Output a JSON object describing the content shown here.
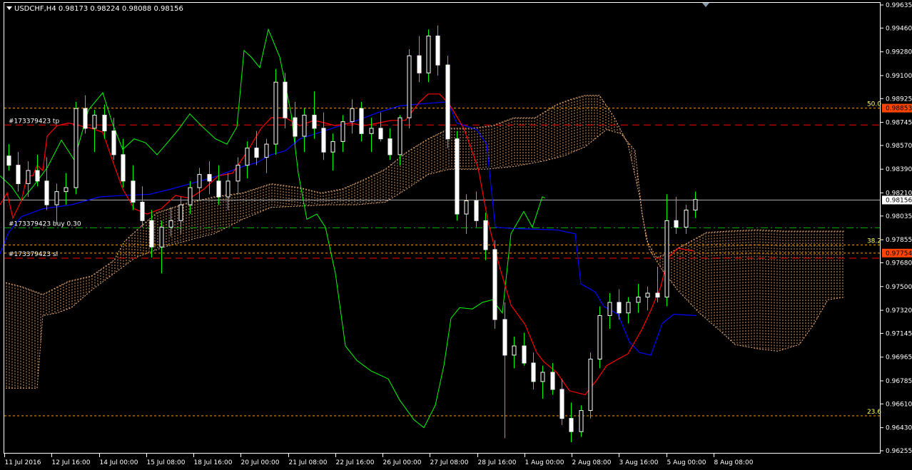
{
  "header": {
    "symbol_line": "USDCHF,H4  0.98173 0.98224 0.98088 0.98156",
    "menu_icon": "triangle-down-icon",
    "scroll_marker_icon": "triangle-down-icon"
  },
  "colors": {
    "background": "#000000",
    "frame": "#ffffff",
    "candle": "#ffffff",
    "wick": "#00ff00",
    "tenkan": "#ff0000",
    "kijun": "#0000ff",
    "chikou": "#00ff00",
    "cloud": "#f0b078",
    "order_line": "#ff0000",
    "buy_line": "#00aa00",
    "fib_line": "#ff9900",
    "current_price_label_bg": "#ffffff",
    "order_price_label_bg": "#ff4500"
  },
  "price_axis": {
    "ticks": [
      "0.99635",
      "0.99460",
      "0.99280",
      "0.99100",
      "0.98925",
      "0.98745",
      "0.98570",
      "0.98390",
      "0.98210",
      "0.98035",
      "0.97855",
      "0.97680",
      "0.97500",
      "0.97320",
      "0.97145",
      "0.96965",
      "0.96785",
      "0.96610",
      "0.96430",
      "0.96255"
    ],
    "current_price": "0.98156",
    "tp_price": "0.98853",
    "sl_price": "0.97754"
  },
  "time_axis": {
    "labels": [
      "11 Jul 2016",
      "12 Jul 16:00",
      "14 Jul 00:00",
      "15 Jul 08:00",
      "18 Jul 16:00",
      "20 Jul 00:00",
      "21 Jul 08:00",
      "22 Jul 16:00",
      "26 Jul 00:00",
      "27 Jul 08:00",
      "28 Jul 16:00",
      "1 Aug 00:00",
      "2 Aug 08:00",
      "3 Aug 16:00",
      "5 Aug 00:00",
      "8 Aug 08:00"
    ]
  },
  "orders": {
    "tp_label": "#173379423 tp",
    "buy_label": "#173379423 buy 0.30",
    "sl_label": "#173379423 sl",
    "tp_value": 0.98725,
    "buy_value": 0.97945,
    "sl_value": 0.97715
  },
  "fibo": {
    "levels": [
      {
        "label": "50.0",
        "value": 0.98853
      },
      {
        "label": "38.2",
        "value": 0.97815
      },
      {
        "label": "23.6",
        "value": 0.9652
      }
    ],
    "extra_line_value": 0.97754
  },
  "chart_data": {
    "type": "candlestick",
    "symbol": "USDCHF",
    "timeframe": "H4",
    "last_bar": {
      "open": 0.98173,
      "high": 0.98224,
      "low": 0.98088,
      "close": 0.98156
    },
    "ylim": [
      0.96255,
      0.99635
    ],
    "candles": [
      [
        0.9849,
        0.9858,
        0.9838,
        0.9842
      ],
      [
        0.9842,
        0.9852,
        0.9822,
        0.9828
      ],
      [
        0.9828,
        0.9845,
        0.9818,
        0.9838
      ],
      [
        0.9838,
        0.985,
        0.9826,
        0.983
      ],
      [
        0.983,
        0.9848,
        0.9808,
        0.9812
      ],
      [
        0.9812,
        0.9828,
        0.9798,
        0.9822
      ],
      [
        0.9822,
        0.9836,
        0.9812,
        0.9825
      ],
      [
        0.9825,
        0.989,
        0.982,
        0.9885
      ],
      [
        0.9885,
        0.9895,
        0.9866,
        0.987
      ],
      [
        0.987,
        0.9884,
        0.9852,
        0.988
      ],
      [
        0.988,
        0.9888,
        0.9862,
        0.9868
      ],
      [
        0.9868,
        0.9878,
        0.9846,
        0.985
      ],
      [
        0.985,
        0.9862,
        0.9825,
        0.983
      ],
      [
        0.983,
        0.9842,
        0.9808,
        0.9814
      ],
      [
        0.9814,
        0.9826,
        0.9795,
        0.98
      ],
      [
        0.98,
        0.9808,
        0.9772,
        0.978
      ],
      [
        0.978,
        0.98,
        0.976,
        0.9795
      ],
      [
        0.9795,
        0.981,
        0.9788,
        0.98
      ],
      [
        0.98,
        0.9818,
        0.979,
        0.9812
      ],
      [
        0.9812,
        0.983,
        0.9805,
        0.9825
      ],
      [
        0.9825,
        0.984,
        0.9815,
        0.9835
      ],
      [
        0.9835,
        0.9845,
        0.982,
        0.983
      ],
      [
        0.983,
        0.9842,
        0.9812,
        0.9818
      ],
      [
        0.9818,
        0.9836,
        0.9808,
        0.983
      ],
      [
        0.983,
        0.9848,
        0.982,
        0.9842
      ],
      [
        0.9842,
        0.986,
        0.9832,
        0.9855
      ],
      [
        0.9855,
        0.9868,
        0.9842,
        0.9848
      ],
      [
        0.9848,
        0.9862,
        0.9836,
        0.9858
      ],
      [
        0.9858,
        0.9915,
        0.985,
        0.9905
      ],
      [
        0.9905,
        0.9912,
        0.987,
        0.9878
      ],
      [
        0.9878,
        0.989,
        0.9858,
        0.9864
      ],
      [
        0.9864,
        0.9885,
        0.9852,
        0.988
      ],
      [
        0.988,
        0.9898,
        0.9862,
        0.987
      ],
      [
        0.987,
        0.9882,
        0.9846,
        0.9852
      ],
      [
        0.9852,
        0.9866,
        0.9838,
        0.986
      ],
      [
        0.986,
        0.988,
        0.9852,
        0.9875
      ],
      [
        0.9875,
        0.9892,
        0.9866,
        0.9885
      ],
      [
        0.9885,
        0.989,
        0.986,
        0.9866
      ],
      [
        0.9866,
        0.9878,
        0.9852,
        0.987
      ],
      [
        0.987,
        0.9882,
        0.986,
        0.9862
      ],
      [
        0.9862,
        0.987,
        0.9846,
        0.985
      ],
      [
        0.985,
        0.988,
        0.9842,
        0.9878
      ],
      [
        0.9878,
        0.993,
        0.987,
        0.9925
      ],
      [
        0.9925,
        0.994,
        0.9905,
        0.9912
      ],
      [
        0.9912,
        0.9945,
        0.9905,
        0.994
      ],
      [
        0.994,
        0.9948,
        0.991,
        0.9918
      ],
      [
        0.9918,
        0.9925,
        0.9855,
        0.9862
      ],
      [
        0.9862,
        0.9868,
        0.98,
        0.9805
      ],
      [
        0.9805,
        0.982,
        0.979,
        0.9815
      ],
      [
        0.9815,
        0.9822,
        0.9795,
        0.98
      ],
      [
        0.98,
        0.9806,
        0.977,
        0.9778
      ],
      [
        0.9778,
        0.9785,
        0.9718,
        0.9725
      ],
      [
        0.9725,
        0.9738,
        0.9635,
        0.9698
      ],
      [
        0.9698,
        0.9712,
        0.9688,
        0.9705
      ],
      [
        0.9705,
        0.9715,
        0.969,
        0.9692
      ],
      [
        0.9692,
        0.97,
        0.9672,
        0.9678
      ],
      [
        0.9678,
        0.969,
        0.9665,
        0.9685
      ],
      [
        0.9685,
        0.9692,
        0.9668,
        0.9672
      ],
      [
        0.9672,
        0.968,
        0.9645,
        0.965
      ],
      [
        0.965,
        0.9662,
        0.9632,
        0.964
      ],
      [
        0.964,
        0.966,
        0.9636,
        0.9656
      ],
      [
        0.9656,
        0.97,
        0.965,
        0.9695
      ],
      [
        0.9695,
        0.9735,
        0.9688,
        0.9728
      ],
      [
        0.9728,
        0.9745,
        0.9718,
        0.9738
      ],
      [
        0.9738,
        0.9748,
        0.9725,
        0.973
      ],
      [
        0.973,
        0.9742,
        0.9722,
        0.9738
      ],
      [
        0.9738,
        0.9752,
        0.973,
        0.9742
      ],
      [
        0.9742,
        0.975,
        0.9732,
        0.9745
      ],
      [
        0.9745,
        0.9765,
        0.9738,
        0.9742
      ],
      [
        0.9742,
        0.982,
        0.9735,
        0.98
      ],
      [
        0.98,
        0.9818,
        0.979,
        0.9795
      ],
      [
        0.9795,
        0.9812,
        0.979,
        0.9808
      ],
      [
        0.9808,
        0.9822,
        0.9802,
        0.9816
      ]
    ],
    "tenkan": [
      [
        0,
        0.9812
      ],
      [
        10,
        0.9821
      ],
      [
        18,
        0.9802
      ],
      [
        30,
        0.9815
      ],
      [
        38,
        0.9834
      ],
      [
        46,
        0.9834
      ],
      [
        52,
        0.9842
      ],
      [
        60,
        0.9838
      ],
      [
        66,
        0.9864
      ],
      [
        80,
        0.9872
      ],
      [
        96,
        0.9874
      ],
      [
        112,
        0.9872
      ],
      [
        128,
        0.987
      ],
      [
        144,
        0.9867
      ],
      [
        160,
        0.9842
      ],
      [
        172,
        0.9824
      ],
      [
        188,
        0.9809
      ],
      [
        206,
        0.9805
      ],
      [
        226,
        0.9809
      ],
      [
        246,
        0.9819
      ],
      [
        266,
        0.9817
      ],
      [
        286,
        0.9824
      ],
      [
        306,
        0.9834
      ],
      [
        326,
        0.9836
      ],
      [
        346,
        0.9852
      ],
      [
        366,
        0.987
      ],
      [
        380,
        0.9878
      ],
      [
        400,
        0.9878
      ],
      [
        420,
        0.9872
      ],
      [
        440,
        0.9876
      ],
      [
        456,
        0.9874
      ],
      [
        470,
        0.9872
      ],
      [
        490,
        0.9874
      ],
      [
        510,
        0.9872
      ],
      [
        530,
        0.9874
      ],
      [
        548,
        0.9876
      ],
      [
        568,
        0.9876
      ],
      [
        588,
        0.989
      ],
      [
        600,
        0.9896
      ],
      [
        616,
        0.9896
      ],
      [
        630,
        0.9888
      ],
      [
        650,
        0.987
      ],
      [
        670,
        0.984
      ],
      [
        684,
        0.9799
      ],
      [
        700,
        0.9765
      ],
      [
        716,
        0.9736
      ],
      [
        736,
        0.9721
      ],
      [
        752,
        0.97
      ],
      [
        762,
        0.9693
      ],
      [
        780,
        0.9685
      ],
      [
        798,
        0.9671
      ],
      [
        820,
        0.9668
      ],
      [
        836,
        0.9679
      ],
      [
        850,
        0.969
      ],
      [
        866,
        0.9695
      ],
      [
        880,
        0.9699
      ],
      [
        900,
        0.9718
      ],
      [
        912,
        0.9732
      ],
      [
        926,
        0.975
      ],
      [
        936,
        0.9772
      ],
      [
        950,
        0.9779
      ],
      [
        972,
        0.9777
      ]
    ],
    "kijun": [
      [
        0,
        0.9775
      ],
      [
        12,
        0.9791
      ],
      [
        30,
        0.9803
      ],
      [
        60,
        0.9809
      ],
      [
        100,
        0.9812
      ],
      [
        140,
        0.9818
      ],
      [
        170,
        0.9819
      ],
      [
        210,
        0.982
      ],
      [
        240,
        0.9824
      ],
      [
        300,
        0.9833
      ],
      [
        320,
        0.9837
      ],
      [
        340,
        0.9841
      ],
      [
        360,
        0.9844
      ],
      [
        380,
        0.985
      ],
      [
        400,
        0.9853
      ],
      [
        420,
        0.9862
      ],
      [
        460,
        0.9869
      ],
      [
        500,
        0.9876
      ],
      [
        530,
        0.9882
      ],
      [
        560,
        0.9887
      ],
      [
        580,
        0.9888
      ],
      [
        600,
        0.9889
      ],
      [
        628,
        0.989
      ],
      [
        640,
        0.9874
      ],
      [
        668,
        0.9869
      ],
      [
        682,
        0.9858
      ],
      [
        694,
        0.9795
      ],
      [
        720,
        0.9794
      ],
      [
        780,
        0.9793
      ],
      [
        806,
        0.979
      ],
      [
        814,
        0.9752
      ],
      [
        834,
        0.9746
      ],
      [
        846,
        0.9735
      ],
      [
        866,
        0.9729
      ],
      [
        882,
        0.9708
      ],
      [
        896,
        0.97
      ],
      [
        912,
        0.9698
      ],
      [
        928,
        0.9722
      ],
      [
        944,
        0.9729
      ],
      [
        976,
        0.9728
      ]
    ],
    "chikou": [
      [
        0,
        0.9834
      ],
      [
        16,
        0.9826
      ],
      [
        30,
        0.9815
      ],
      [
        48,
        0.9827
      ],
      [
        66,
        0.984
      ],
      [
        86,
        0.9861
      ],
      [
        104,
        0.9846
      ],
      [
        124,
        0.9884
      ],
      [
        144,
        0.9897
      ],
      [
        158,
        0.9873
      ],
      [
        172,
        0.9854
      ],
      [
        188,
        0.9862
      ],
      [
        204,
        0.9859
      ],
      [
        220,
        0.985
      ],
      [
        236,
        0.986
      ],
      [
        250,
        0.9869
      ],
      [
        266,
        0.9881
      ],
      [
        282,
        0.9872
      ],
      [
        302,
        0.9862
      ],
      [
        318,
        0.9858
      ],
      [
        332,
        0.9871
      ],
      [
        342,
        0.9929
      ],
      [
        352,
        0.9924
      ],
      [
        364,
        0.9916
      ],
      [
        376,
        0.9945
      ],
      [
        392,
        0.9924
      ],
      [
        408,
        0.9881
      ],
      [
        418,
        0.9836
      ],
      [
        430,
        0.9801
      ],
      [
        444,
        0.9805
      ],
      [
        456,
        0.9795
      ],
      [
        470,
        0.976
      ],
      [
        484,
        0.9705
      ],
      [
        500,
        0.9694
      ],
      [
        520,
        0.9686
      ],
      [
        544,
        0.968
      ],
      [
        560,
        0.9664
      ],
      [
        580,
        0.9649
      ],
      [
        594,
        0.9643
      ],
      [
        610,
        0.966
      ],
      [
        622,
        0.969
      ],
      [
        632,
        0.9726
      ],
      [
        644,
        0.9734
      ],
      [
        662,
        0.9733
      ],
      [
        676,
        0.9738
      ],
      [
        690,
        0.974
      ],
      [
        704,
        0.973
      ],
      [
        716,
        0.979
      ],
      [
        734,
        0.9807
      ],
      [
        746,
        0.9795
      ],
      [
        760,
        0.9818
      ],
      [
        764,
        0.9817
      ]
    ],
    "cloud_upper": [
      [
        8,
        0.9753
      ],
      [
        30,
        0.975
      ],
      [
        60,
        0.9744
      ],
      [
        96,
        0.9754
      ],
      [
        128,
        0.9758
      ],
      [
        160,
        0.977
      ],
      [
        174,
        0.9784
      ],
      [
        196,
        0.9795
      ],
      [
        220,
        0.9806
      ],
      [
        260,
        0.9813
      ],
      [
        300,
        0.9818
      ],
      [
        340,
        0.9821
      ],
      [
        380,
        0.9828
      ],
      [
        420,
        0.9825
      ],
      [
        450,
        0.9821
      ],
      [
        480,
        0.9824
      ],
      [
        510,
        0.9831
      ],
      [
        540,
        0.9839
      ],
      [
        570,
        0.9852
      ],
      [
        600,
        0.9862
      ],
      [
        630,
        0.987
      ],
      [
        660,
        0.987
      ],
      [
        690,
        0.9872
      ],
      [
        720,
        0.9878
      ],
      [
        750,
        0.9878
      ],
      [
        780,
        0.9888
      ],
      [
        800,
        0.9892
      ],
      [
        820,
        0.9895
      ],
      [
        840,
        0.9895
      ],
      [
        860,
        0.9879
      ],
      [
        880,
        0.9858
      ],
      [
        896,
        0.9819
      ],
      [
        906,
        0.9785
      ],
      [
        920,
        0.9772
      ],
      [
        940,
        0.9776
      ],
      [
        960,
        0.9782
      ],
      [
        990,
        0.9791
      ],
      [
        1020,
        0.9792
      ],
      [
        1060,
        0.9793
      ],
      [
        1100,
        0.9792
      ],
      [
        1140,
        0.9792
      ],
      [
        1170,
        0.9792
      ],
      [
        1184,
        0.9792
      ]
    ],
    "cloud_lower": [
      [
        8,
        0.9673
      ],
      [
        30,
        0.9673
      ],
      [
        52,
        0.9673
      ],
      [
        60,
        0.9728
      ],
      [
        80,
        0.973
      ],
      [
        100,
        0.9734
      ],
      [
        130,
        0.9748
      ],
      [
        160,
        0.976
      ],
      [
        190,
        0.9772
      ],
      [
        230,
        0.978
      ],
      [
        270,
        0.9786
      ],
      [
        300,
        0.979
      ],
      [
        340,
        0.9801
      ],
      [
        380,
        0.981
      ],
      [
        420,
        0.9811
      ],
      [
        460,
        0.9812
      ],
      [
        500,
        0.9812
      ],
      [
        540,
        0.9814
      ],
      [
        570,
        0.9824
      ],
      [
        600,
        0.9835
      ],
      [
        630,
        0.9839
      ],
      [
        680,
        0.9839
      ],
      [
        720,
        0.9841
      ],
      [
        760,
        0.9845
      ],
      [
        790,
        0.9849
      ],
      [
        820,
        0.9856
      ],
      [
        850,
        0.9869
      ],
      [
        870,
        0.9866
      ],
      [
        890,
        0.9853
      ],
      [
        900,
        0.9804
      ],
      [
        910,
        0.9778
      ],
      [
        930,
        0.9761
      ],
      [
        950,
        0.9747
      ],
      [
        980,
        0.973
      ],
      [
        1010,
        0.9716
      ],
      [
        1030,
        0.9706
      ],
      [
        1060,
        0.9703
      ],
      [
        1090,
        0.9701
      ],
      [
        1120,
        0.9706
      ],
      [
        1140,
        0.9721
      ],
      [
        1160,
        0.974
      ],
      [
        1184,
        0.9742
      ]
    ]
  }
}
